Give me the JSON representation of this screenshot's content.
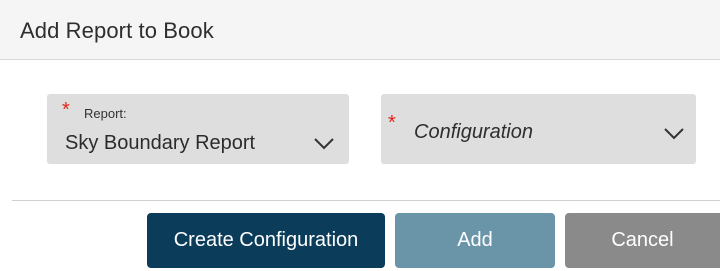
{
  "dialog": {
    "title": "Add Report to Book"
  },
  "fields": {
    "report": {
      "required_mark": "*",
      "label": "Report:",
      "value": "Sky Boundary Report",
      "icon": "chevron-down-icon"
    },
    "configuration": {
      "required_mark": "*",
      "placeholder": "Configuration",
      "icon": "chevron-down-icon"
    }
  },
  "buttons": {
    "create_configuration": "Create Configuration",
    "add": "Add",
    "cancel": "Cancel"
  },
  "colors": {
    "required": "#e2231a",
    "primary": "#0b3d5a",
    "add_disabled": "#6a94a8",
    "cancel": "#8a8a8a",
    "field_bg": "#dedede"
  }
}
